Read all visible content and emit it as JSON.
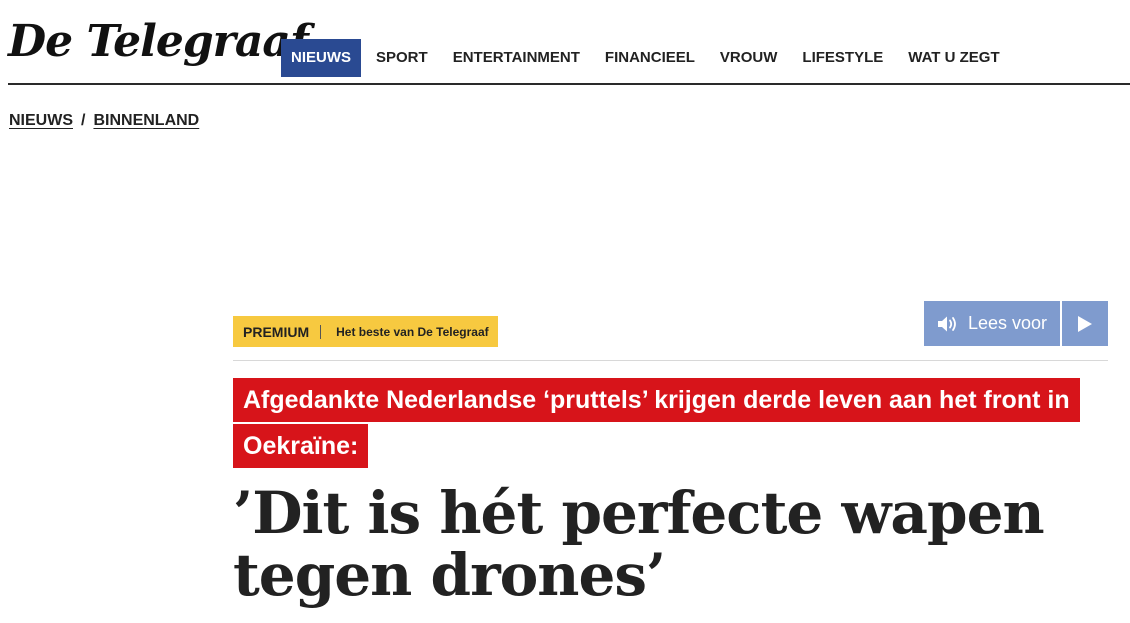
{
  "brand": {
    "logo_text": "De Telegraaf"
  },
  "nav": {
    "items": [
      {
        "label": "NIEUWS",
        "active": true
      },
      {
        "label": "SPORT"
      },
      {
        "label": "ENTERTAINMENT"
      },
      {
        "label": "FINANCIEEL"
      },
      {
        "label": "VROUW"
      },
      {
        "label": "LIFESTYLE"
      },
      {
        "label": "WAT U ZEGT"
      }
    ],
    "active_color": "#2a4a92"
  },
  "breadcrumb": {
    "items": [
      "NIEUWS",
      "BINNENLAND"
    ],
    "separator": "/"
  },
  "premium_badge": {
    "label": "PREMIUM",
    "tagline": "Het beste van De Telegraaf",
    "color": "#f7c940"
  },
  "listen": {
    "label": "Lees voor",
    "speaker_icon": "speaker-icon",
    "play_icon": "play-icon",
    "color": "#7f9bce"
  },
  "article": {
    "kicker_lines": [
      "Afgedankte Nederlandse ‘pruttels’ krijgen derde leven aan het front in",
      "Oekraïne:"
    ],
    "kicker_color": "#d7141a",
    "headline_lines": [
      "’Dit is hét perfecte wapen",
      "tegen drones’"
    ]
  }
}
